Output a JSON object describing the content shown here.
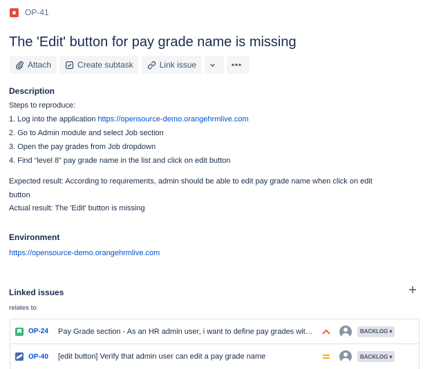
{
  "issue": {
    "key": "OP-41",
    "type_icon": "bug-icon",
    "title": "The 'Edit' button for pay grade name is missing"
  },
  "toolbar": {
    "attach_label": "Attach",
    "create_subtask_label": "Create subtask",
    "link_issue_label": "Link issue",
    "more_icon": "ellipsis-icon",
    "dropdown_icon": "chevron-down-icon"
  },
  "description": {
    "heading": "Description",
    "lines": [
      "Steps to reproduce:",
      "1. Log into the application ",
      "2. Go to Admin module and select Job section",
      "3. Open the pay grades from Job dropdown",
      "4. Find “level 8” pay grade name in the list and click on edit button"
    ],
    "link_url": "https://opensource-demo.orangehrmlive.com",
    "expected_line_1": "Expected result: According to requirements, admin should be able to edit pay grade name when click on edit",
    "expected_line_2": "button",
    "actual": "Actual result: The 'Edit' button is missing"
  },
  "environment": {
    "heading": "Environment",
    "url": "https://opensource-demo.orangehrmlive.com"
  },
  "linked_issues": {
    "heading": "Linked issues",
    "relation": "relates to",
    "add_icon": "plus-icon",
    "items": [
      {
        "type_icon": "story-icon",
        "key": "OP-24",
        "summary": "Pay Grade section - As an HR admin user, i want to define pay grades with specified salary range of eac...",
        "priority_icon": "priority-high-icon",
        "status": "BACKLOG"
      },
      {
        "type_icon": "task-icon",
        "key": "OP-40",
        "summary": "[edit button] Verify that admin user can edit a pay grade name",
        "priority_icon": "priority-medium-icon",
        "status": "BACKLOG"
      }
    ]
  },
  "colors": {
    "link": "#0052cc",
    "bug": "#e5493a",
    "story": "#36b37e",
    "priority_high": "#ff5630",
    "priority_medium": "#ffab00"
  }
}
